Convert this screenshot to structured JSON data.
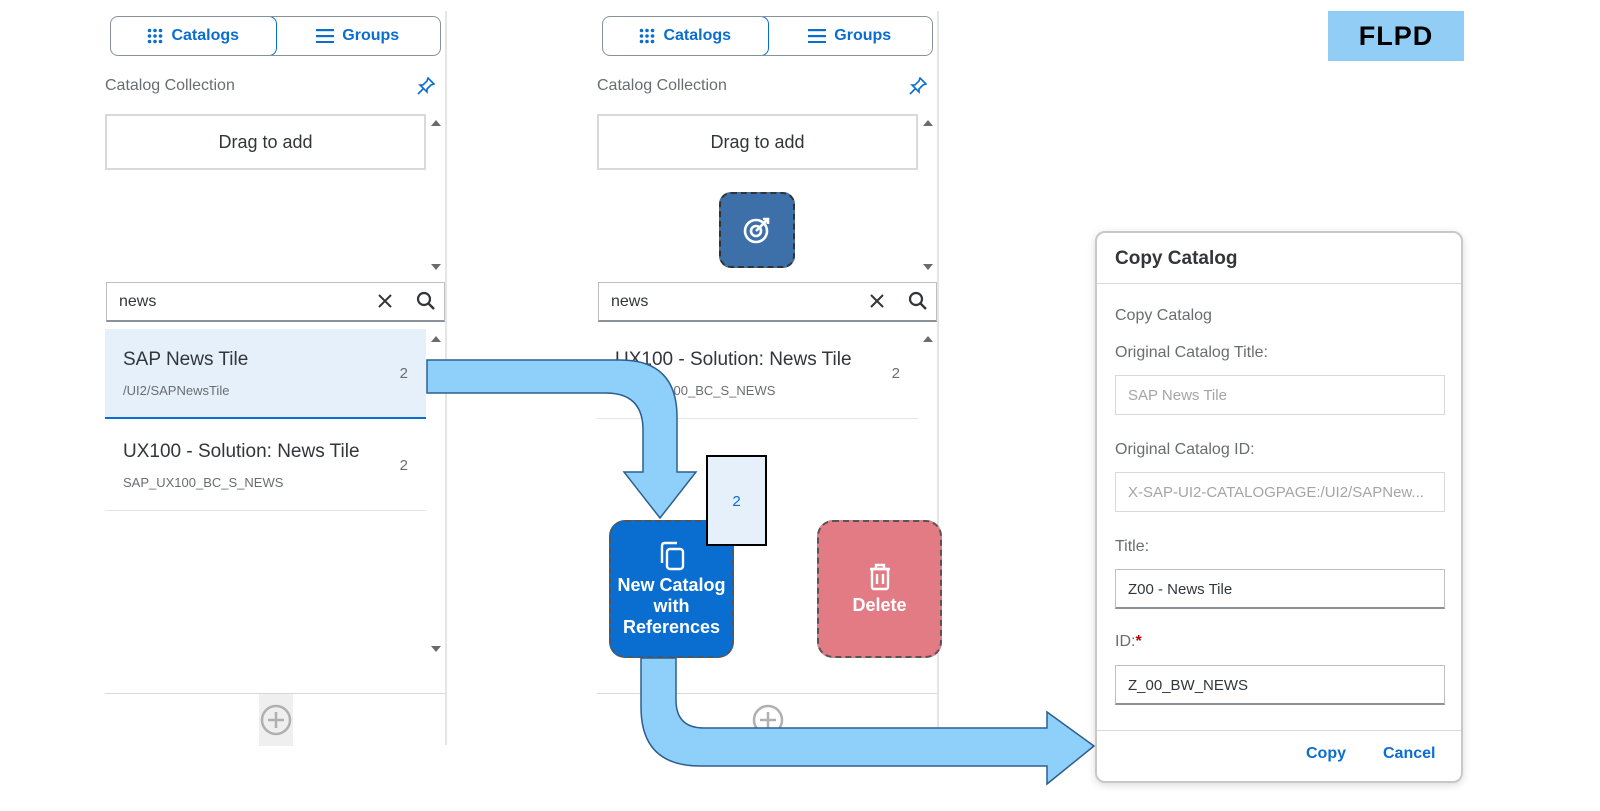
{
  "badge": {
    "text": "FLPD"
  },
  "panels": [
    {
      "tabs": [
        {
          "label": "Catalogs"
        },
        {
          "label": "Groups"
        }
      ],
      "collection_label": "Catalog Collection",
      "dropzone_label": "Drag to add",
      "search_value": "news",
      "items": [
        {
          "title": "SAP News Tile",
          "subtitle": "/UI2/SAPNewsTile",
          "count": "2"
        },
        {
          "title": "UX100 - Solution: News Tile",
          "subtitle": "SAP_UX100_BC_S_NEWS",
          "count": "2"
        }
      ]
    },
    {
      "tabs": [
        {
          "label": "Catalogs"
        },
        {
          "label": "Groups"
        }
      ],
      "collection_label": "Catalog Collection",
      "dropzone_label": "Drag to add",
      "search_value": "news",
      "items": [
        {
          "title": "UX100 - Solution: News Tile",
          "subtitle": "SAP_UX100_BC_S_NEWS",
          "count": "2"
        }
      ]
    }
  ],
  "drag_ghost": {
    "count": "2"
  },
  "action_tiles": {
    "new_catalog": {
      "lines": [
        "New Catalog",
        "with",
        "References"
      ]
    },
    "delete": {
      "label": "Delete"
    }
  },
  "dialog": {
    "title": "Copy Catalog",
    "section": "Copy Catalog",
    "original_title_label": "Original Catalog Title:",
    "original_title_value": "SAP News Tile",
    "original_id_label": "Original Catalog ID:",
    "original_id_value": "X-SAP-UI2-CATALOGPAGE:/UI2/SAPNew...",
    "title_label": "Title:",
    "title_value": "Z00 - News Tile",
    "id_label": "ID:",
    "id_required": "*",
    "id_value": "Z_00_BW_NEWS",
    "copy_label": "Copy",
    "cancel_label": "Cancel"
  },
  "colors": {
    "accent": "#0a6ed1",
    "arrow_fill": "#8fd0fb",
    "delete_tile": "#e37b84",
    "badge_bg": "#91cdf5"
  }
}
